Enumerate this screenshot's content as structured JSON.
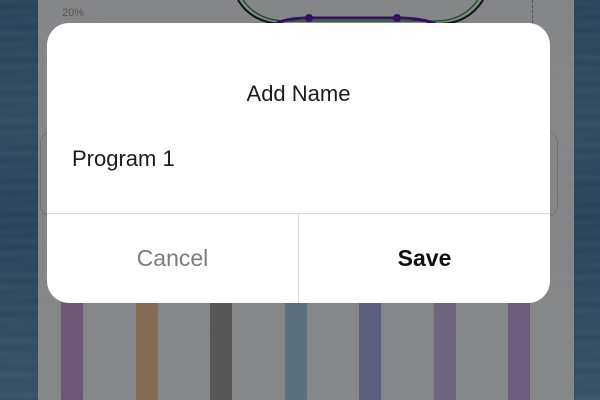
{
  "background": {
    "chart_label": "20%",
    "bar_colors": [
      "#c7a3d6",
      "#f0c79a",
      "#9e9e9e",
      "#a9cde6",
      "#a9b0e2",
      "#cbb8e6",
      "#c7a8e0"
    ],
    "curve_color": "#5b1fb5"
  },
  "dialog": {
    "title": "Add Name",
    "name_value": "Program 1",
    "cancel_label": "Cancel",
    "save_label": "Save"
  },
  "colors": {
    "overlay": "rgba(0,0,0,0.45)",
    "cancel_text": "#7c7c7c",
    "save_text": "#111111"
  }
}
